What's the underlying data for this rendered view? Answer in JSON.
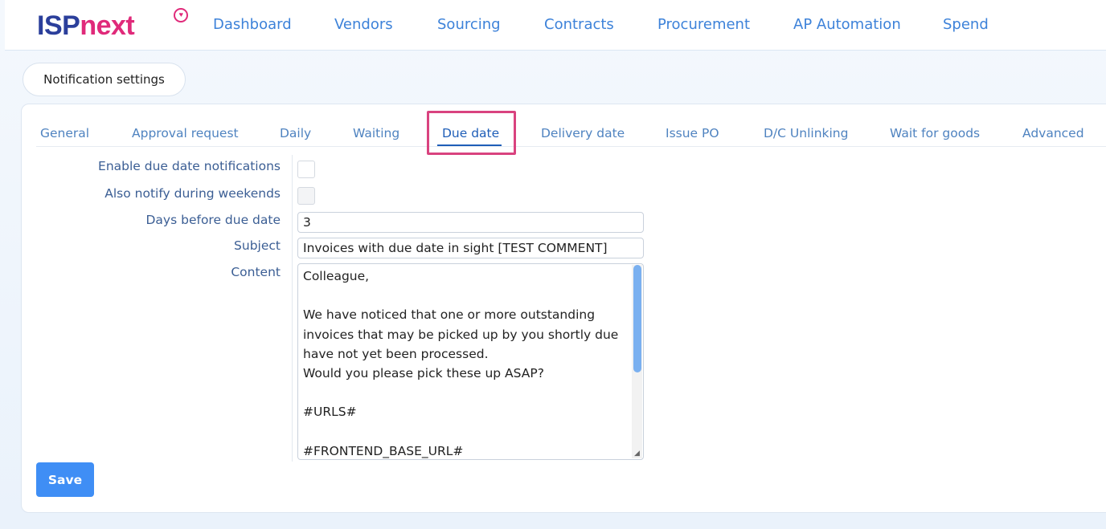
{
  "logo": {
    "brand_primary": "ISP",
    "brand_secondary": "next"
  },
  "nav": {
    "items": [
      "Dashboard",
      "Vendors",
      "Sourcing",
      "Contracts",
      "Procurement",
      "AP Automation",
      "Spend"
    ]
  },
  "page": {
    "title": "Notification settings"
  },
  "tabs": {
    "items": [
      "General",
      "Approval request",
      "Daily",
      "Waiting",
      "Due date",
      "Delivery date",
      "Issue PO",
      "D/C Unlinking",
      "Wait for goods",
      "Advanced"
    ],
    "active": "Due date"
  },
  "form": {
    "enable_label": "Enable due date notifications",
    "weekends_label": "Also notify during weekends",
    "days_label": "Days before due date",
    "days_value": "3",
    "subject_label": "Subject",
    "subject_value": "Invoices with due date in sight [TEST COMMENT]",
    "content_label": "Content",
    "content_value": "Colleague,\n\nWe have noticed that one or more outstanding invoices that may be picked up by you shortly due have not yet been processed.\nWould you please pick these up ASAP?\n\n#URLS#\n\n#FRONTEND_BASE_URL#",
    "enable_checked": false,
    "weekends_checked": false
  },
  "actions": {
    "save_label": "Save"
  },
  "colors": {
    "brand_blue": "#2b3f9b",
    "brand_pink": "#e02a7a",
    "nav_link": "#3d82d9",
    "tab_active": "#1f5eb8",
    "highlight_box": "#d9437f",
    "primary_button": "#3f8ef5"
  }
}
